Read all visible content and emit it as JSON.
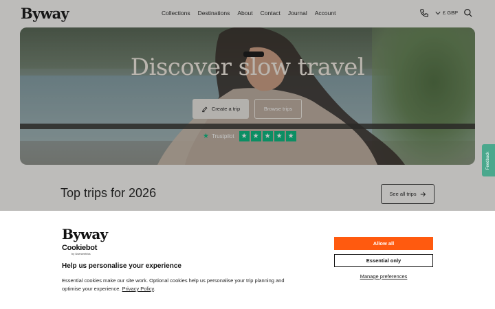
{
  "header": {
    "logo": "Byway",
    "nav": [
      "Collections",
      "Destinations",
      "About",
      "Contact",
      "Journal",
      "Account"
    ],
    "currency": "£ GBP",
    "phone_icon": "phone-icon",
    "search_icon": "search-icon",
    "chevron_icon": "chevron-down-icon"
  },
  "hero": {
    "title": "Discover slow travel",
    "create_trip": "Create a trip",
    "browse_trips": "Browse trips",
    "trustpilot": "Trustpilot",
    "rating_stars": 5
  },
  "section": {
    "title": "Top trips for 2026",
    "see_all": "See all trips"
  },
  "feedback": "Feedback",
  "cookie": {
    "logo": "Byway",
    "cookiebot": "Cookiebot",
    "cookiebot_sub": "by Usercentrics",
    "heading": "Help us personalise your experience",
    "text": "Essential cookies make our site work. Optional cookies help us personalise your trip planning and optimise your experience.",
    "privacy_link": "Privacy Policy",
    "allow_all": "Allow all",
    "essential_only": "Essential only",
    "manage": "Manage preferences"
  },
  "colors": {
    "accent": "#ff5a0f",
    "trustpilot_green": "#00b67a",
    "feedback_tab": "#4aa88d"
  }
}
